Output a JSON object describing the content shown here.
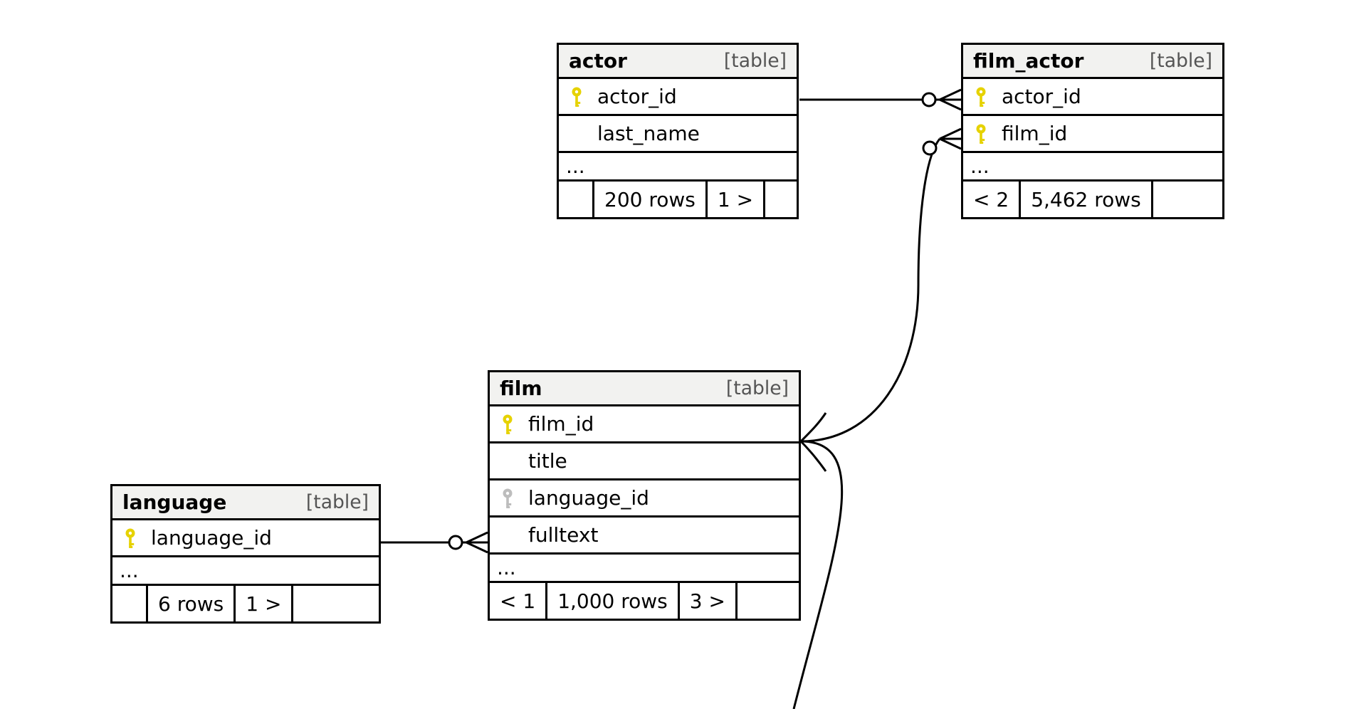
{
  "kind_label": "[table]",
  "ellipsis": "...",
  "tables": {
    "actor": {
      "name": "actor",
      "columns": [
        {
          "name": "actor_id",
          "pk": true
        },
        {
          "name": "last_name",
          "pk": false
        }
      ],
      "footer": {
        "left_nav": "",
        "rows": "200 rows",
        "right_nav": "1 >"
      }
    },
    "film_actor": {
      "name": "film_actor",
      "columns": [
        {
          "name": "actor_id",
          "pk": true
        },
        {
          "name": "film_id",
          "pk": true
        }
      ],
      "footer": {
        "left_nav": "< 2",
        "rows": "5,462 rows",
        "right_nav": ""
      }
    },
    "language": {
      "name": "language",
      "columns": [
        {
          "name": "language_id",
          "pk": true
        }
      ],
      "footer": {
        "left_nav": "",
        "rows": "6 rows",
        "right_nav": "1 >"
      }
    },
    "film": {
      "name": "film",
      "columns": [
        {
          "name": "film_id",
          "pk": true
        },
        {
          "name": "title",
          "pk": false
        },
        {
          "name": "language_id",
          "pk": false,
          "fk": true
        },
        {
          "name": "fulltext",
          "pk": false
        }
      ],
      "footer": {
        "left_nav": "< 1",
        "rows": "1,000 rows",
        "right_nav": "3 >"
      }
    }
  },
  "relationships": [
    {
      "from": "language.language_id",
      "to": "film.language_id",
      "type": "one-to-many"
    },
    {
      "from": "actor.actor_id",
      "to": "film_actor.actor_id",
      "type": "one-to-many"
    },
    {
      "from": "film.film_id",
      "to": "film_actor.film_id",
      "type": "one-to-many"
    }
  ]
}
